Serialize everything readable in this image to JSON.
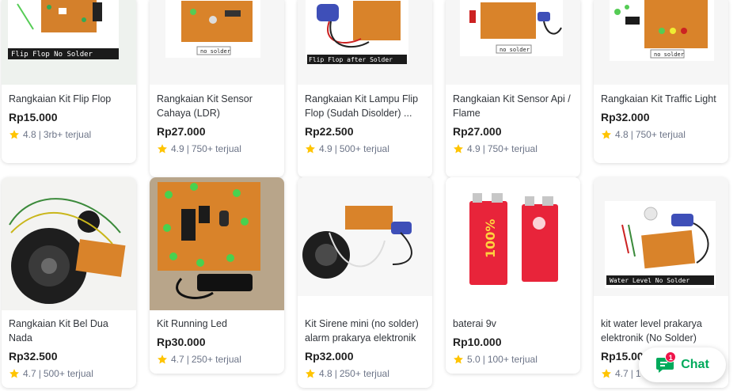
{
  "products": [
    {
      "name": "Rangkaian Kit Flip Flop",
      "price": "Rp15.000",
      "rating": "4.8",
      "sold": "3rb+ terjual",
      "image_caption": "Flip Flop No Solder",
      "image_icon": "pcb-kit-photo"
    },
    {
      "name": "Rangkaian Kit Sensor Cahaya (LDR)",
      "price": "Rp27.000",
      "rating": "4.9",
      "sold": "750+ terjual",
      "image_caption": "no solder",
      "image_icon": "pcb-kit-photo"
    },
    {
      "name": "Rangkaian Kit Lampu Flip Flop (Sudah Disolder) ...",
      "price": "Rp22.500",
      "rating": "4.9",
      "sold": "500+ terjual",
      "image_caption": "Flip Flop after Solder",
      "image_icon": "pcb-kit-photo"
    },
    {
      "name": "Rangkaian Kit Sensor Api / Flame",
      "price": "Rp27.000",
      "rating": "4.9",
      "sold": "750+ terjual",
      "image_caption": "no solder",
      "image_icon": "pcb-kit-photo"
    },
    {
      "name": "Rangkaian Kit Traffic Light",
      "price": "Rp32.000",
      "rating": "4.8",
      "sold": "750+ terjual",
      "image_caption": "no solder",
      "image_icon": "pcb-kit-photo"
    },
    {
      "name": "Rangkaian Kit Bel Dua Nada",
      "price": "Rp32.500",
      "rating": "4.7",
      "sold": "500+ terjual",
      "image_caption": "",
      "image_icon": "speaker-kit-photo"
    },
    {
      "name": "Kit Running Led",
      "price": "Rp30.000",
      "rating": "4.7",
      "sold": "250+ terjual",
      "image_caption": "",
      "image_icon": "led-board-photo"
    },
    {
      "name": "Kit Sirene mini (no solder) alarm prakarya elektronik",
      "price": "Rp32.000",
      "rating": "4.8",
      "sold": "250+ terjual",
      "image_caption": "",
      "image_icon": "speaker-kit-photo"
    },
    {
      "name": "baterai 9v",
      "price": "Rp10.000",
      "rating": "5.0",
      "sold": "100+ terjual",
      "image_caption": "",
      "image_icon": "battery-photo"
    },
    {
      "name": "kit water level prakarya elektronik (No Solder)",
      "price": "Rp15.00",
      "rating": "4.7",
      "sold": "1",
      "image_caption": "Water Level No Solder",
      "image_icon": "pcb-kit-photo"
    }
  ],
  "chat": {
    "label": "Chat",
    "badge": "1",
    "icon": "chat-bubble-icon"
  },
  "colors": {
    "accent_green": "#00aa5b",
    "star": "#ffc400",
    "badge": "#ef144a",
    "pcb": "#d9832a"
  }
}
